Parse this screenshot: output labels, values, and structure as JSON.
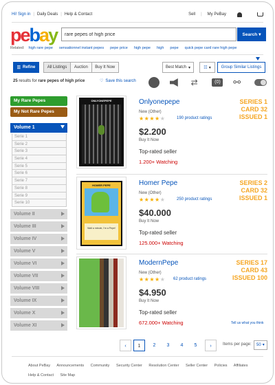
{
  "topbar": {
    "greeting": "Hi! Sign in",
    "links": [
      "Daily Deals",
      "Help & Contact"
    ],
    "right": [
      "Sell",
      "My PeBay"
    ]
  },
  "logo": {
    "letters": [
      "p",
      "e",
      "b",
      "a",
      "y"
    ]
  },
  "search": {
    "value": "rare pepes of high price",
    "button": "Search"
  },
  "related": {
    "label": "Related:",
    "items": [
      "high rare pepe",
      "sensationnel instant pepes",
      "pepe price",
      "high pepe",
      "high",
      "pepe",
      "quick pepe card rare high pepe"
    ]
  },
  "toolbar": {
    "refine": "Refine",
    "filters": [
      "All Listings",
      "Auction",
      "Buy It Now"
    ],
    "sort": "Best Match",
    "group": "Group Similar Listings"
  },
  "results": {
    "count": "25",
    "text": "results for",
    "query": "rare pepes of high price",
    "save": "Save this search"
  },
  "sidebar": {
    "my_rare": "My Rare Pepes",
    "my_not_rare": "My Not Rare Pepes",
    "open_volume": "Volume 1",
    "series": [
      "Serie 1",
      "Serie 2",
      "Serie 3",
      "Serie 4",
      "Serie 5",
      "Serie 6",
      "Serie 7",
      "Serie 8",
      "Serie 9",
      "Serie 10"
    ],
    "volumes": [
      "Volume II",
      "Volume III",
      "Volume IV",
      "Volume V",
      "Volume VI",
      "Volume VII",
      "Volume VIII",
      "Volume IX",
      "Volume X",
      "Volume XI"
    ]
  },
  "items": [
    {
      "title": "Onlyonepepe",
      "condition": "New (Other)",
      "stars": 4,
      "ratings": "190 product ratings",
      "price": "$2.200",
      "buy": "Buy It Now",
      "seller": "Top-rated seller",
      "watching": "1.200+ Watching",
      "tag": [
        "SERIES 1",
        "CARD 32",
        "ISSUED 1"
      ],
      "card_label": "ONLYONEPEPE"
    },
    {
      "title": "Homer Pepe",
      "condition": "New (Other)",
      "stars": 4,
      "ratings": "250 product ratings",
      "price": "$40.000",
      "buy": "Buy It Now",
      "seller": "Top-rated seller",
      "watching": "125.000+ Watching",
      "tag": [
        "SERIES 2",
        "CARD 32",
        "ISSUED 1"
      ],
      "card_label": "HOMER PEPE",
      "card_text": "Wait a minute, I'm a Pepe!"
    },
    {
      "title": "ModernPepe",
      "condition": "New (Other)",
      "stars": 4,
      "ratings": "62 product ratings",
      "price": "$4.950",
      "buy": "Buy It Now",
      "seller": "Top-rated seller",
      "watching": "672.000+ Watching",
      "tag": [
        "SERIES 17",
        "CARD 43",
        "ISSUED 100"
      ]
    }
  ],
  "feedback": "Tell us what you think",
  "pagination": {
    "prev": "‹",
    "next": "›",
    "pages": [
      "1",
      "2",
      "3",
      "4",
      "5"
    ],
    "per_page_label": "Items per page:",
    "per_page": "50"
  },
  "footer": [
    "About PeBay",
    "Announcements",
    "Community",
    "Security Center",
    "Resolution Center",
    "Seller Center",
    "Policies",
    "Affiliates",
    "Help & Contact",
    "Site Map"
  ],
  "colors": {
    "brand_blue": "#0654ba",
    "accent_orange": "#f5a623",
    "watch_red": "#cc0000",
    "green": "#2e9d2e",
    "brown": "#9a5b14"
  }
}
